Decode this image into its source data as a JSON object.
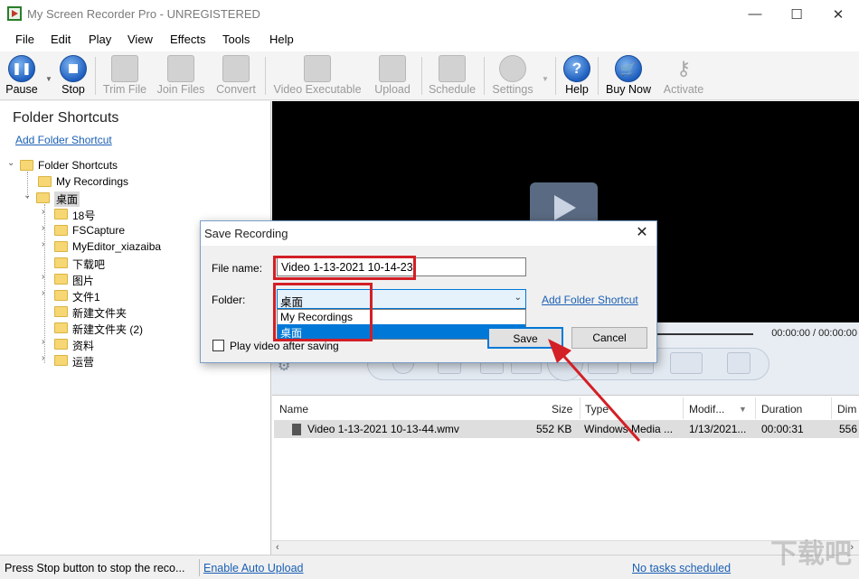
{
  "window": {
    "title": "My Screen Recorder Pro - UNREGISTERED",
    "minimize": "—",
    "maximize": "☐",
    "close": "✕"
  },
  "menu": [
    "File",
    "Edit",
    "Play",
    "View",
    "Effects",
    "Tools",
    "Help"
  ],
  "toolbar": [
    {
      "label": "Pause",
      "icon": "pause-icon",
      "enabled": true
    },
    {
      "label": "Stop",
      "icon": "stop-icon",
      "enabled": true
    },
    {
      "label": "Trim File",
      "icon": "scissors-film-icon",
      "enabled": false
    },
    {
      "label": "Join Files",
      "icon": "join-film-icon",
      "enabled": false
    },
    {
      "label": "Convert",
      "icon": "convert-icon",
      "enabled": false
    },
    {
      "label": "Video Executable",
      "icon": "exe-film-icon",
      "enabled": false
    },
    {
      "label": "Upload",
      "icon": "upload-icon",
      "enabled": false
    },
    {
      "label": "Schedule",
      "icon": "schedule-icon",
      "enabled": false
    },
    {
      "label": "Settings",
      "icon": "gear-icon",
      "enabled": false
    },
    {
      "label": "Help",
      "icon": "help-icon",
      "enabled": true
    },
    {
      "label": "Buy Now",
      "icon": "cart-icon",
      "enabled": true
    },
    {
      "label": "Activate",
      "icon": "keys-icon",
      "enabled": false
    }
  ],
  "left_panel": {
    "title": "Folder Shortcuts",
    "add_link": "Add Folder Shortcut",
    "tree": [
      {
        "label": "Folder Shortcuts",
        "expander": "⌄"
      },
      {
        "label": "My Recordings",
        "expander": ""
      },
      {
        "label": "桌面",
        "expander": "⌄"
      },
      {
        "label": "18号",
        "expander": "›"
      },
      {
        "label": "FSCapture",
        "expander": "›"
      },
      {
        "label": "MyEditor_xiazaiba",
        "expander": "›"
      },
      {
        "label": "下载吧",
        "expander": ""
      },
      {
        "label": "图片",
        "expander": "›"
      },
      {
        "label": "文件1",
        "expander": "›"
      },
      {
        "label": "新建文件夹",
        "expander": ""
      },
      {
        "label": "新建文件夹 (2)",
        "expander": ""
      },
      {
        "label": "资料",
        "expander": "›"
      },
      {
        "label": "运营",
        "expander": "›"
      }
    ]
  },
  "player": {
    "time": "00:00:00 / 00:00:00"
  },
  "file_list": {
    "columns": [
      "Name",
      "Size",
      "Type",
      "Modif...",
      "Duration",
      "Dim"
    ],
    "rows": [
      {
        "name": "Video 1-13-2021 10-13-44.wmv",
        "size": "552 KB",
        "type": "Windows Media ...",
        "modified": "1/13/2021...",
        "duration": "00:00:31",
        "dim": "556"
      }
    ]
  },
  "status": {
    "text": "Press Stop button to stop the reco...",
    "auto_upload": "Enable Auto Upload",
    "tasks": "No tasks scheduled"
  },
  "dialog": {
    "title": "Save Recording",
    "close": "✕",
    "filename_label": "File name:",
    "filename_value": "Video 1-13-2021 10-14-23",
    "folder_label": "Folder:",
    "folder_value": "桌面",
    "folder_options": [
      "My Recordings",
      "桌面"
    ],
    "add_link": "Add Folder Shortcut",
    "play_after_label": "Play video after saving",
    "save_label": "Save",
    "cancel_label": "Cancel"
  },
  "watermark": "下载吧",
  "colors": {
    "highlight": "#d31f26",
    "link": "#1a5fb4",
    "selection": "#0078d7"
  }
}
